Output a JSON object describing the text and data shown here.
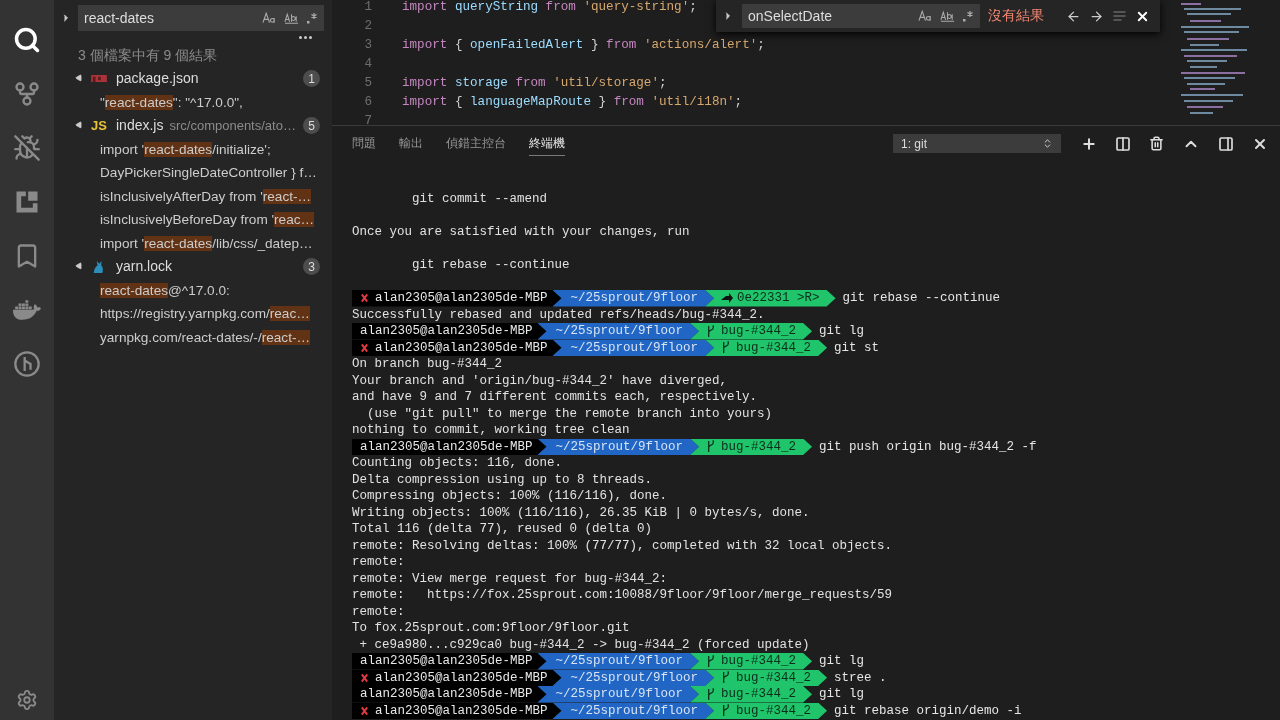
{
  "activity_bar": {
    "items": [
      {
        "kind": "search",
        "selected": true
      },
      {
        "kind": "source-control",
        "selected": false
      },
      {
        "kind": "debug",
        "selected": false
      },
      {
        "kind": "extensions",
        "selected": false
      },
      {
        "kind": "bookmarks",
        "selected": false
      },
      {
        "kind": "docker",
        "selected": false
      },
      {
        "kind": "git-graph",
        "selected": false
      }
    ],
    "settings": {
      "kind": "settings"
    }
  },
  "search_panel": {
    "query": "react-dates",
    "summary": "3 個檔案中有 9 個結果",
    "files": [
      {
        "name": "package.json",
        "icon": {
          "kind": "npm"
        },
        "count": "1",
        "expanded": true,
        "matches": [
          [
            {
              "text": "\"",
              "match": false
            },
            {
              "text": "react-dates",
              "match": true
            },
            {
              "text": "\": \"^17.0.0\",",
              "match": false
            }
          ]
        ]
      },
      {
        "name": "index.js",
        "path": "src/components/ato…",
        "icon": {
          "kind": "js",
          "text": "JS"
        },
        "count": "5",
        "expanded": true,
        "matches": [
          [
            {
              "text": "import '",
              "match": false
            },
            {
              "text": "react-dates",
              "match": true
            },
            {
              "text": "/initialize';",
              "match": false
            }
          ],
          [
            {
              "text": "DayPickerSingleDateController } f…",
              "match": false
            }
          ],
          [
            {
              "text": "isInclusivelyAfterDay from '",
              "match": false
            },
            {
              "text": "react-…",
              "match": true
            }
          ],
          [
            {
              "text": "isInclusivelyBeforeDay from '",
              "match": false
            },
            {
              "text": "reac…",
              "match": true
            }
          ],
          [
            {
              "text": "import '",
              "match": false
            },
            {
              "text": "react-dates",
              "match": true
            },
            {
              "text": "/lib/css/_datep…",
              "match": false
            }
          ]
        ]
      },
      {
        "name": "yarn.lock",
        "icon": {
          "kind": "yarn"
        },
        "count": "3",
        "expanded": true,
        "matches": [
          [
            {
              "text": "react-dates",
              "match": true
            },
            {
              "text": "@^17.0.0:",
              "match": false
            }
          ],
          [
            {
              "text": "https://registry.yarnpkg.com/",
              "match": false
            },
            {
              "text": "reac…",
              "match": true
            }
          ],
          [
            {
              "text": "yarnpkg.com/react-dates/-/",
              "match": false
            },
            {
              "text": "react-…",
              "match": true
            }
          ]
        ]
      }
    ]
  },
  "editor": {
    "lines": [
      {
        "number": "1",
        "tokens": [
          {
            "kind": "keyword",
            "text": "import"
          },
          {
            "kind": "ident",
            "text": " queryString"
          },
          {
            "kind": "keyword",
            "text": " from"
          },
          {
            "kind": "string",
            "text": " 'query-string'"
          },
          {
            "kind": "punct",
            "text": ";"
          }
        ]
      },
      {
        "number": "2"
      },
      {
        "number": "3",
        "tokens": [
          {
            "kind": "keyword",
            "text": "import"
          },
          {
            "kind": "punct",
            "text": " {"
          },
          {
            "kind": "ident",
            "text": " openFailedAlert"
          },
          {
            "kind": "punct",
            "text": " }"
          },
          {
            "kind": "keyword",
            "text": " from"
          },
          {
            "kind": "string",
            "text": " 'actions/alert'"
          },
          {
            "kind": "punct",
            "text": ";"
          }
        ]
      },
      {
        "number": "4"
      },
      {
        "number": "5",
        "tokens": [
          {
            "kind": "keyword",
            "text": "import"
          },
          {
            "kind": "ident",
            "text": " storage"
          },
          {
            "kind": "keyword",
            "text": " from"
          },
          {
            "kind": "string",
            "text": " 'util/storage'"
          },
          {
            "kind": "punct",
            "text": ";"
          }
        ]
      },
      {
        "number": "6",
        "tokens": [
          {
            "kind": "keyword",
            "text": "import"
          },
          {
            "kind": "punct",
            "text": " {"
          },
          {
            "kind": "ident",
            "text": " languageMapRoute"
          },
          {
            "kind": "punct",
            "text": " }"
          },
          {
            "kind": "keyword",
            "text": " from"
          },
          {
            "kind": "string",
            "text": " 'util/i18n'"
          },
          {
            "kind": "punct",
            "text": ";"
          }
        ]
      },
      {
        "number": "7"
      }
    ],
    "find_widget": {
      "value": "onSelectDate",
      "result": "沒有結果"
    }
  },
  "panel": {
    "tabs": [
      {
        "label": "問題",
        "selected": false
      },
      {
        "label": "輸出",
        "selected": false
      },
      {
        "label": "偵錯主控台",
        "selected": false
      },
      {
        "label": "終端機",
        "selected": true
      }
    ],
    "terminal_select": "1: git",
    "terminal": [
      {
        "kind": "text",
        "text": "        git commit --amend"
      },
      {
        "kind": "blank"
      },
      {
        "kind": "text",
        "text": "Once you are satisfied with your changes, run"
      },
      {
        "kind": "blank"
      },
      {
        "kind": "text",
        "text": "        git rebase --continue"
      },
      {
        "kind": "blank"
      },
      {
        "kind": "prompt",
        "error": true,
        "user": "alan2305@alan2305de-MBP",
        "path": "~/25sprout/9floor",
        "ref": {
          "kind": "detached",
          "text": "0e22331 >R>"
        },
        "command": "git rebase --continue"
      },
      {
        "kind": "text",
        "text": "Successfully rebased and updated refs/heads/bug-#344_2."
      },
      {
        "kind": "prompt",
        "error": false,
        "user": "alan2305@alan2305de-MBP",
        "path": "~/25sprout/9floor",
        "ref": {
          "kind": "branch",
          "text": "bug-#344_2"
        },
        "command": "git lg"
      },
      {
        "kind": "prompt",
        "error": true,
        "user": "alan2305@alan2305de-MBP",
        "path": "~/25sprout/9floor",
        "ref": {
          "kind": "branch",
          "text": "bug-#344_2"
        },
        "command": "git st"
      },
      {
        "kind": "text",
        "text": "On branch bug-#344_2"
      },
      {
        "kind": "text",
        "text": "Your branch and 'origin/bug-#344_2' have diverged,"
      },
      {
        "kind": "text",
        "text": "and have 9 and 7 different commits each, respectively."
      },
      {
        "kind": "text",
        "text": "  (use \"git pull\" to merge the remote branch into yours)"
      },
      {
        "kind": "text",
        "text": "nothing to commit, working tree clean"
      },
      {
        "kind": "prompt",
        "error": false,
        "user": "alan2305@alan2305de-MBP",
        "path": "~/25sprout/9floor",
        "ref": {
          "kind": "branch",
          "text": "bug-#344_2"
        },
        "command": "git push origin bug-#344_2 -f"
      },
      {
        "kind": "text",
        "text": "Counting objects: 116, done."
      },
      {
        "kind": "text",
        "text": "Delta compression using up to 8 threads."
      },
      {
        "kind": "text",
        "text": "Compressing objects: 100% (116/116), done."
      },
      {
        "kind": "text",
        "text": "Writing objects: 100% (116/116), 26.35 KiB | 0 bytes/s, done."
      },
      {
        "kind": "text",
        "text": "Total 116 (delta 77), reused 0 (delta 0)"
      },
      {
        "kind": "text",
        "text": "remote: Resolving deltas: 100% (77/77), completed with 32 local objects."
      },
      {
        "kind": "text",
        "text": "remote:"
      },
      {
        "kind": "text",
        "text": "remote: View merge request for bug-#344_2:"
      },
      {
        "kind": "text",
        "text": "remote:   https://fox.25sprout.com:10088/9floor/9floor/merge_requests/59"
      },
      {
        "kind": "text",
        "text": "remote:"
      },
      {
        "kind": "text",
        "text": "To fox.25sprout.com:9floor/9floor.git"
      },
      {
        "kind": "text",
        "text": " + ce9a980...c929ca0 bug-#344_2 -> bug-#344_2 (forced update)"
      },
      {
        "kind": "prompt",
        "error": false,
        "user": "alan2305@alan2305de-MBP",
        "path": "~/25sprout/9floor",
        "ref": {
          "kind": "branch",
          "text": "bug-#344_2"
        },
        "command": "git lg"
      },
      {
        "kind": "prompt",
        "error": true,
        "user": "alan2305@alan2305de-MBP",
        "path": "~/25sprout/9floor",
        "ref": {
          "kind": "branch",
          "text": "bug-#344_2"
        },
        "command": "stree ."
      },
      {
        "kind": "prompt",
        "error": false,
        "user": "alan2305@alan2305de-MBP",
        "path": "~/25sprout/9floor",
        "ref": {
          "kind": "branch",
          "text": "bug-#344_2"
        },
        "command": "git lg"
      },
      {
        "kind": "prompt",
        "error": true,
        "user": "alan2305@alan2305de-MBP",
        "path": "~/25sprout/9floor",
        "ref": {
          "kind": "branch",
          "text": "bug-#344_2"
        },
        "command": "git rebase origin/demo -i"
      }
    ]
  }
}
